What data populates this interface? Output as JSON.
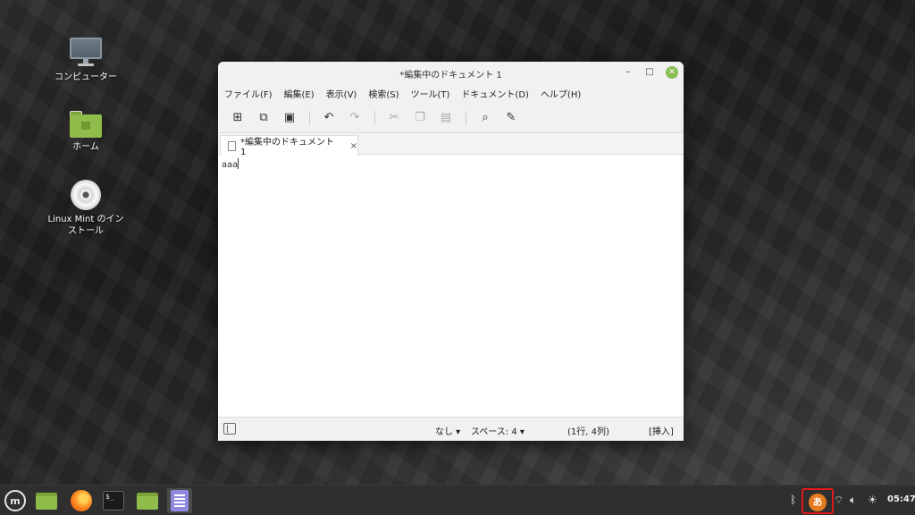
{
  "desktop": {
    "icons": [
      {
        "label": "コンピューター",
        "icon": "computer-icon"
      },
      {
        "label": "ホーム",
        "icon": "home-folder-icon"
      },
      {
        "label": "Linux Mint のインストール",
        "icon": "install-disc-icon"
      }
    ]
  },
  "window": {
    "title": "*編集中のドキュメント 1",
    "buttons": {
      "minimize": "–",
      "maximize": "□",
      "close": "✕"
    },
    "menu": [
      "ファイル(F)",
      "編集(E)",
      "表示(V)",
      "検索(S)",
      "ツール(T)",
      "ドキュメント(D)",
      "ヘルプ(H)"
    ],
    "toolbar": {
      "new": "new-document-icon",
      "open": "open-icon",
      "save": "save-icon",
      "undo": "undo-icon",
      "redo": "redo-icon",
      "cut": "cut-icon",
      "copy": "copy-icon",
      "paste": "paste-icon",
      "search": "search-icon",
      "replace": "replace-icon"
    },
    "tab": {
      "label": "*編集中のドキュメント 1",
      "close": "×"
    },
    "editor": {
      "content": "aaa"
    },
    "statusbar": {
      "syntax": "なし ▾",
      "tab_width": "スペース: 4 ▾",
      "position": "(1行, 4列)",
      "mode": "[挿入]"
    }
  },
  "taskbar": {
    "items": [
      "menu-icon",
      "files-icon",
      "firefox-icon",
      "terminal-icon",
      "folder-icon",
      "text-editor-icon"
    ],
    "tray": {
      "bluetooth": "bluetooth-icon",
      "ime": "あ",
      "network": "wifi-icon",
      "volume": "volume-icon",
      "brightness": "brightness-icon",
      "time": "05:47"
    },
    "accent_highlight": "#e0191c"
  }
}
